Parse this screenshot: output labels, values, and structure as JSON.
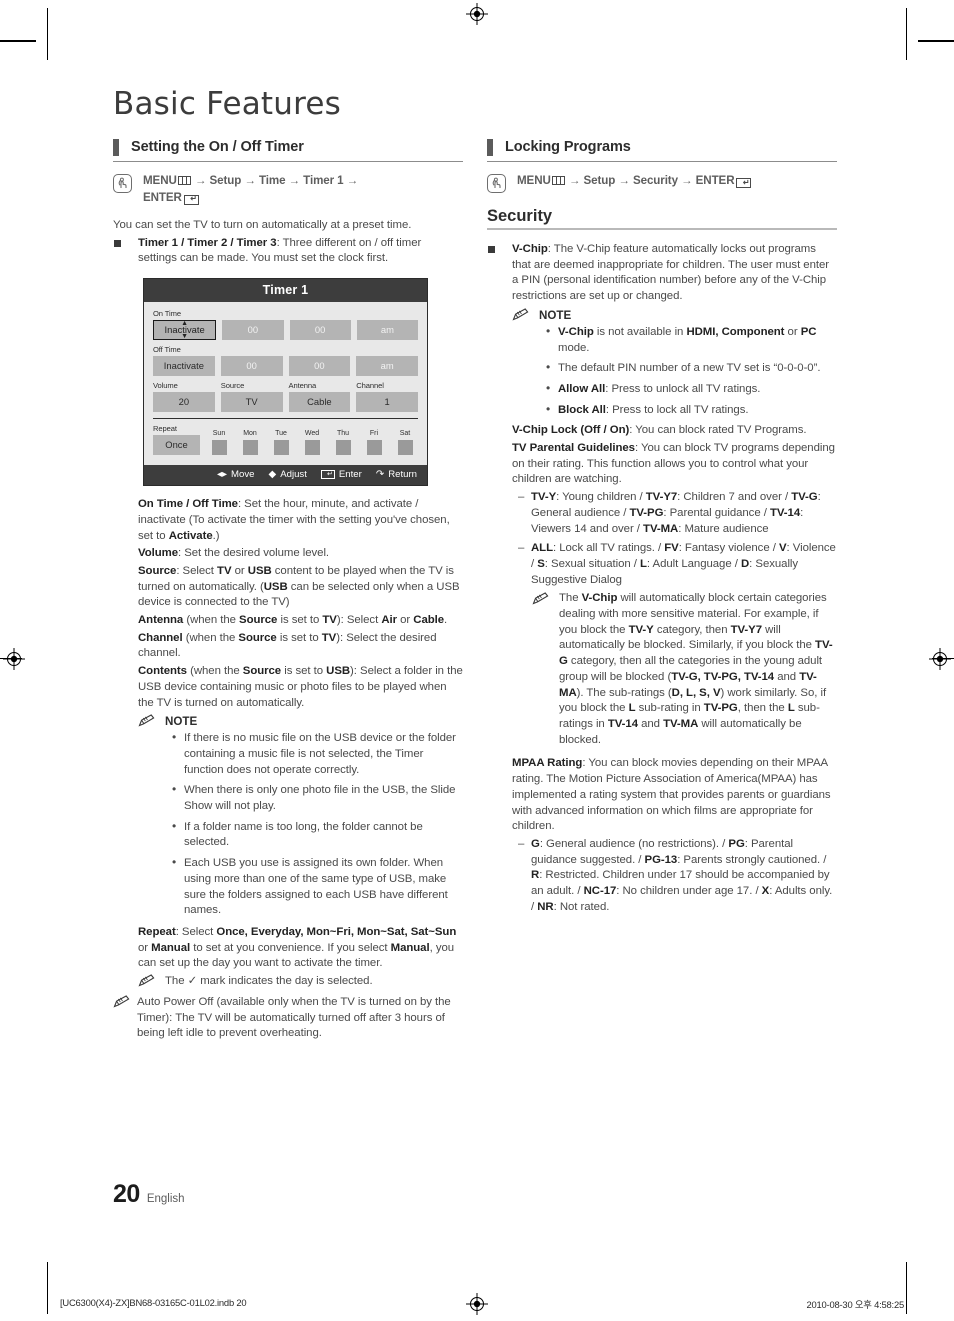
{
  "document": {
    "title": "Basic Features",
    "page_number": "20",
    "language_label": "English",
    "footer_left": "[UC6300(X4)-ZX]BN68-03165C-01L02.indb   20",
    "footer_right": "2010-08-30   오후 4:58:25"
  },
  "left_column": {
    "section_heading": "Setting the On / Off Timer",
    "menu_path": {
      "prefix": "MENU",
      "menu_icon": "menu-grid-icon",
      "steps": [
        "Setup",
        "Time",
        "Timer 1"
      ],
      "enter_label": "ENTER",
      "enter_icon": "enter-key-icon"
    },
    "intro": "You can set the TV to turn on automatically at a preset time.",
    "timer_item": {
      "label": "Timer 1 / Timer 2 / Timer 3",
      "text": ": Three different on / off timer settings can be made. You must set the clock first."
    },
    "osd": {
      "title": "Timer 1",
      "on_time_label": "On Time",
      "on_time_values": [
        "Inactivate",
        "00",
        "00",
        "am"
      ],
      "off_time_label": "Off Time",
      "off_time_values": [
        "Inactivate",
        "00",
        "00",
        "am"
      ],
      "quad_labels": [
        "Volume",
        "Source",
        "Antenna",
        "Channel"
      ],
      "quad_values": [
        "20",
        "TV",
        "Cable",
        "1"
      ],
      "repeat_label": "Repeat",
      "repeat_value": "Once",
      "days": [
        "Sun",
        "Mon",
        "Tue",
        "Wed",
        "Thu",
        "Fri",
        "Sat"
      ],
      "footer_actions": [
        "Move",
        "Adjust",
        "Enter",
        "Return"
      ]
    },
    "descriptions": [
      {
        "term": "On Time / Off Time",
        "html": "<b>On Time / Off Time</b>: Set the hour, minute, and activate / inactivate (To activate the timer with the setting you've chosen, set to <b>Activate</b>.)"
      },
      {
        "term": "Volume",
        "html": "<b>Volume</b>: Set the desired volume level."
      },
      {
        "term": "Source",
        "html": "<b>Source</b>: Select <b>TV</b> or <b>USB</b> content to be played when the TV is turned on automatically. (<b>USB</b> can be selected only when a USB device is connected to the TV)"
      },
      {
        "term": "Antenna",
        "html": "<b>Antenna</b> (when the <b>Source</b> is set to <b>TV</b>): Select <b>Air</b> or <b>Cable</b>."
      },
      {
        "term": "Channel",
        "html": "<b>Channel</b> (when the <b>Source</b> is set to <b>TV</b>): Select the desired channel."
      },
      {
        "term": "Contents",
        "html": "<b>Contents</b> (when the <b>Source</b> is set to <b>USB</b>): Select a folder in the USB device containing music or photo files to be played when the TV is turned on automatically."
      }
    ],
    "note_label": "NOTE",
    "notes": [
      "If there is no music file on the USB device or the folder containing a music file is not selected, the Timer function does not operate correctly.",
      "When there is only one photo file in the USB, the Slide Show will not play.",
      "If a folder name is too long, the folder cannot be selected.",
      "Each USB you use is assigned its own folder. When using more than one of the same type of USB, make sure the folders assigned to each USB have different names."
    ],
    "repeat_desc_html": "<b>Repeat</b>: Select <b>Once, Everyday, Mon~Fri, Mon~Sat, Sat~Sun</b> or <b>Manual</b> to set at you convenience. If you select <b>Manual</b>, you can set up the day you want to activate the timer.",
    "check_note_html": "The ✓ mark indicates the day is selected.",
    "auto_power_note": "Auto Power Off (available only when the TV is turned on by the Timer): The TV will be automatically turned off after 3 hours of being left idle to prevent overheating."
  },
  "right_column": {
    "section_heading": "Locking Programs",
    "menu_path": {
      "prefix": "MENU",
      "menu_icon": "menu-grid-icon",
      "steps": [
        "Setup",
        "Security"
      ],
      "enter_label": "ENTER",
      "enter_icon": "enter-key-icon"
    },
    "subhead": "Security",
    "vchip_html": "<b>V-Chip</b>: The V-Chip feature automatically locks out programs that are deemed inappropriate for children. The user must enter a PIN (personal identification number) before any of the V-Chip restrictions are set up or changed.",
    "note_label": "NOTE",
    "notes_html": [
      "<b>V-Chip</b> is not available in <b>HDMI, Component</b> or <b>PC</b> mode.",
      "The default PIN number of a new TV set is “0-0-0-0”.",
      "<b>Allow All</b>: Press to unlock all TV ratings.",
      "<b>Block All</b>: Press to lock all TV ratings."
    ],
    "vchip_lock_html": "<b>V-Chip Lock (Off / On)</b>: You can block rated TV Programs.",
    "tv_parental_html": "<b>TV Parental Guidelines</b>: You can block TV programs depending on their rating. This function allows you to control what your children are watching.",
    "rating_dashes_html": [
      "<b>TV-Y</b>: Young children / <b>TV-Y7</b>: Children 7 and over / <b>TV-G</b>: General audience / <b>TV-PG</b>: Parental guidance / <b>TV-14</b>: Viewers 14 and over / <b>TV-MA</b>: Mature audience",
      "<b>ALL</b>: Lock all TV ratings. / <b>FV</b>: Fantasy violence / <b>V</b>: Violence / <b>S</b>: Sexual situation / <b>L</b>: Adult Language / <b>D</b>: Sexually Suggestive Dialog"
    ],
    "vchip_auto_note_html": "The <b>V-Chip</b> will automatically block certain categories dealing with more sensitive material. For example, if you block the <b>TV-Y</b> category, then <b>TV-Y7</b> will automatically be blocked. Similarly, if you block the <b>TV-G</b> category, then all the categories in the young adult group will be blocked (<b>TV-G, TV-PG, TV-14</b> and <b>TV-MA</b>). The sub-ratings (<b>D, L, S, V</b>) work similarly. So, if you block the <b>L</b> sub-rating in <b>TV-PG</b>, then the <b>L</b> sub-ratings in <b>TV-14</b> and <b>TV-MA</b> will automatically be blocked.",
    "mpaa_html": "<b>MPAA Rating</b>: You can block movies depending on their MPAA rating. The Motion Picture Association of America(MPAA) has implemented a rating system that provides parents or guardians with advanced information on which films are appropriate for children.",
    "mpaa_dash_html": "<b>G</b>: General audience (no restrictions). / <b>PG</b>: Parental guidance suggested. / <b>PG-13</b>: Parents strongly cautioned. / <b>R</b>: Restricted. Children under 17 should be accompanied by an adult. / <b>NC-17</b>: No children under age 17. / <b>X</b>: Adults only. / <b>NR</b>: Not rated."
  },
  "colors": {
    "text": "#4a4a4a",
    "heading": "#2d2d2d",
    "osd_header": "#3d3d3d",
    "osd_panel": "#e8e8e8",
    "osd_cell": "#b4b4b4",
    "rule": "#8c8c8c"
  }
}
